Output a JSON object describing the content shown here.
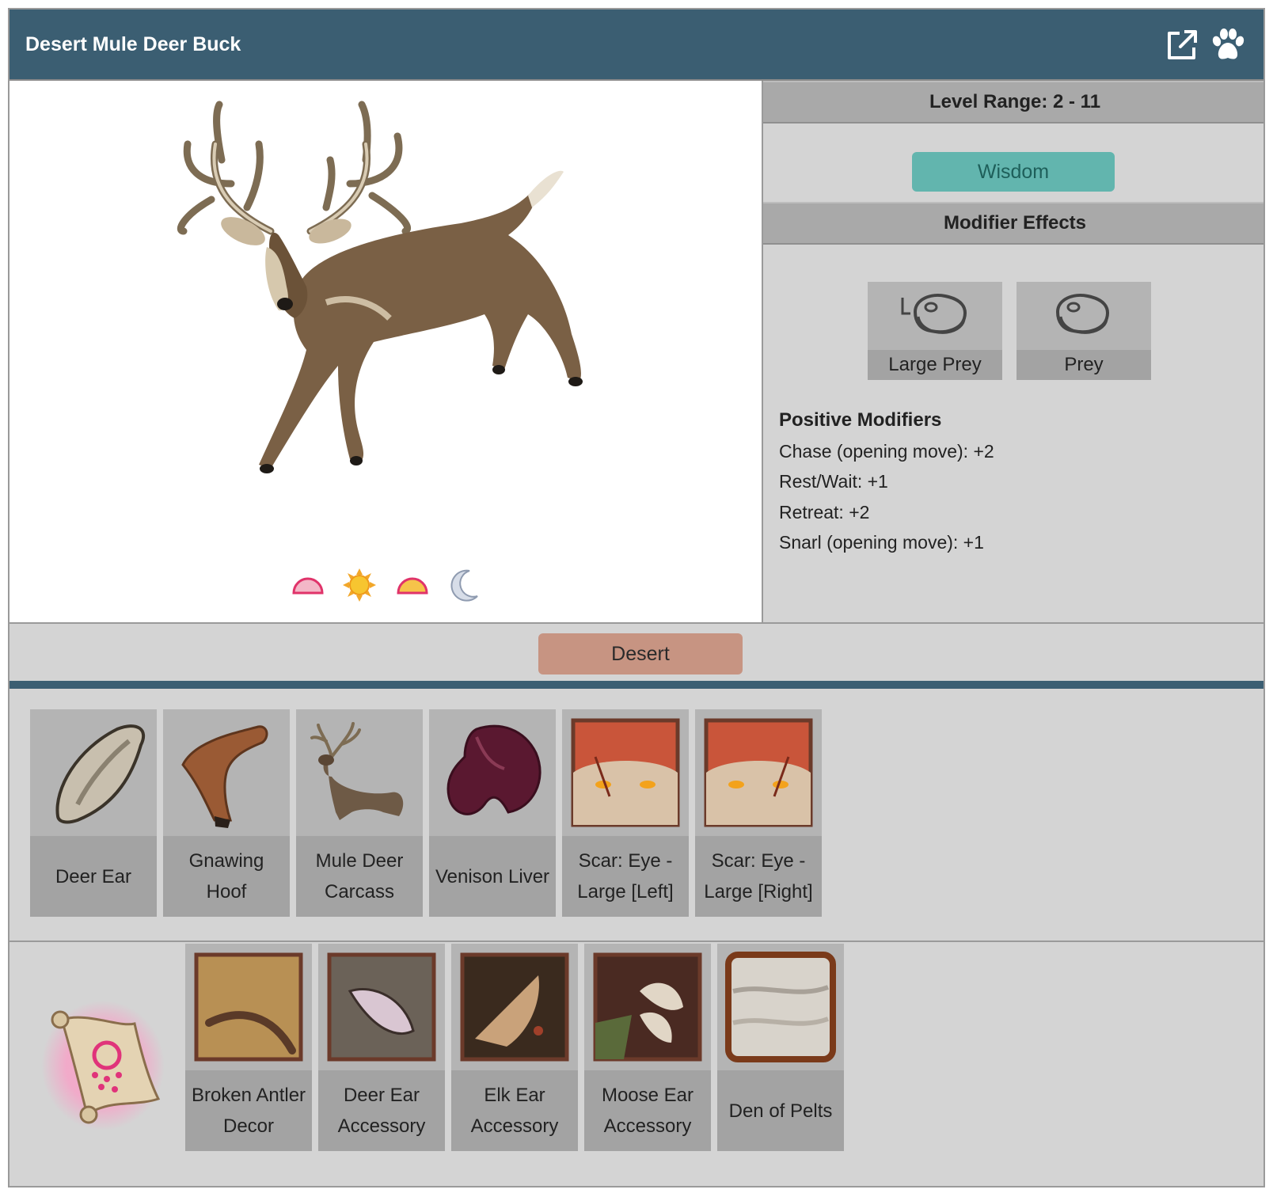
{
  "header": {
    "title": "Desert Mule Deer Buck",
    "icons": [
      "external-link-icon",
      "paw-icon"
    ]
  },
  "times_of_day": [
    "dawn-icon",
    "day-icon",
    "dusk-icon",
    "night-icon"
  ],
  "level_range": "Level Range: 2 - 11",
  "stat": {
    "label": "Wisdom",
    "color": "#62b5ae"
  },
  "modifier_effects": {
    "title": "Modifier Effects",
    "cards": [
      {
        "label": "Large Prey",
        "icon": "large-prey-icon"
      },
      {
        "label": "Prey",
        "icon": "prey-icon"
      }
    ],
    "positive_title": "Positive Modifiers",
    "positive": [
      "Chase (opening move): +2",
      "Rest/Wait: +1",
      "Retreat: +2",
      "Snarl (opening move): +1"
    ]
  },
  "habitat": {
    "label": "Desert",
    "color": "#c79482"
  },
  "drops": [
    {
      "name": "Deer Ear",
      "icon": "deer-ear-icon"
    },
    {
      "name": "Gnawing Hoof",
      "icon": "gnawing-hoof-icon"
    },
    {
      "name": "Mule Deer Carcass",
      "icon": "mule-deer-carcass-icon"
    },
    {
      "name": "Venison Liver",
      "icon": "venison-liver-icon"
    },
    {
      "name": "Scar: Eye - Large [Left]",
      "icon": "scar-eye-left-icon"
    },
    {
      "name": "Scar: Eye - Large [Right]",
      "icon": "scar-eye-right-icon"
    }
  ],
  "rewards": [
    {
      "name": "Broken Antler Decor",
      "icon": "broken-antler-decor-icon"
    },
    {
      "name": "Deer Ear Accessory",
      "icon": "deer-ear-accessory-icon"
    },
    {
      "name": "Elk Ear Accessory",
      "icon": "elk-ear-accessory-icon"
    },
    {
      "name": "Moose Ear Accessory",
      "icon": "moose-ear-accessory-icon"
    },
    {
      "name": "Den of Pelts",
      "icon": "den-of-pelts-icon"
    }
  ],
  "colors": {
    "header": "#3b5e72",
    "panel": "#d4d4d4",
    "card": "#b4b4b4"
  }
}
